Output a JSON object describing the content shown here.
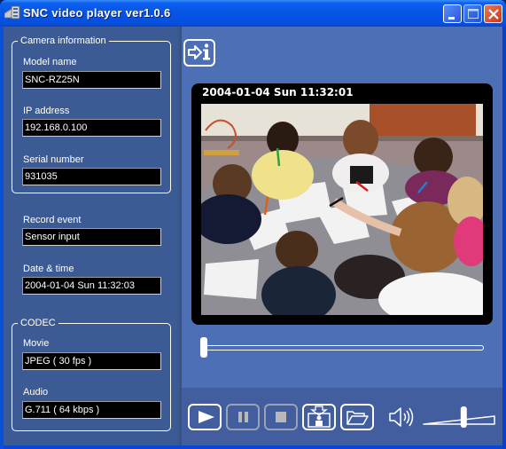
{
  "window": {
    "title": "SNC video player ver1.0.6",
    "controls": [
      "minimize",
      "maximize",
      "close"
    ]
  },
  "camera_info": {
    "legend": "Camera information",
    "model_name": {
      "label": "Model name",
      "value": "SNC-RZ25N"
    },
    "ip_address": {
      "label": "IP address",
      "value": "192.168.0.100"
    },
    "serial_number": {
      "label": "Serial number",
      "value": "931035"
    }
  },
  "record_event": {
    "label": "Record event",
    "value": "Sensor input"
  },
  "date_time": {
    "label": "Date & time",
    "value": "2004-01-04 Sun 11:32:03"
  },
  "codec": {
    "legend": "CODEC",
    "movie": {
      "label": "Movie",
      "value": "JPEG ( 30 fps )"
    },
    "audio": {
      "label": "Audio",
      "value": "G.711 ( 64 kbps )"
    }
  },
  "video": {
    "timestamp": "2004-01-04 Sun 11:32:01",
    "scene": "children drawing at a round table with a teacher"
  },
  "playback": {
    "seek_position_fraction": 0.0,
    "volume_fraction": 0.55,
    "buttons": [
      {
        "id": "play",
        "icon": "play-icon",
        "enabled": true
      },
      {
        "id": "pause",
        "icon": "pause-icon",
        "enabled": false
      },
      {
        "id": "stop",
        "icon": "stop-icon",
        "enabled": false
      },
      {
        "id": "save-image",
        "icon": "save-image-icon",
        "enabled": true
      },
      {
        "id": "open",
        "icon": "folder-open-icon",
        "enabled": true
      }
    ]
  },
  "colors": {
    "title_bar": "#0753e4",
    "left_panel": "#3c5b94",
    "right_panel": "#4d6fb6",
    "close_button": "#c6381a"
  }
}
